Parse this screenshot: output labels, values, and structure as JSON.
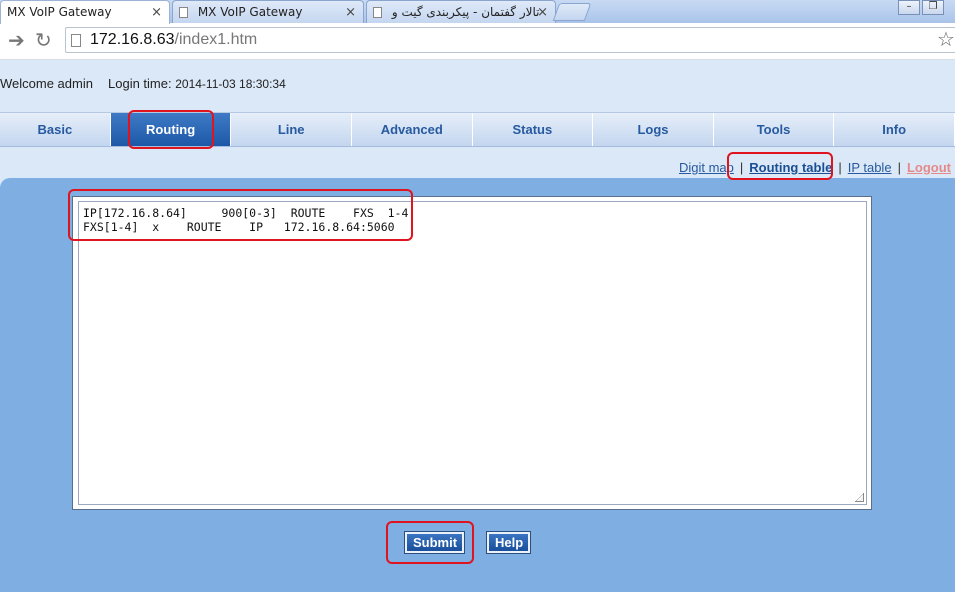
{
  "browser": {
    "tabs": [
      {
        "title": "MX VoIP Gateway",
        "close": "×"
      },
      {
        "title": "MX VoIP Gateway",
        "close": "×"
      },
      {
        "title": "تالار گفتمان - پیکربندی گیت و",
        "close": "×"
      }
    ],
    "window_buttons": {
      "minimize": "–",
      "restore": "❐"
    },
    "url_host": "172.16.8.63",
    "url_path": "/index1.htm"
  },
  "header": {
    "welcome": "Welcome admin",
    "login_label": "Login time:",
    "login_time": "2014-11-03 18:30:34"
  },
  "menu": {
    "items": [
      "Basic",
      "Routing",
      "Line",
      "Advanced",
      "Status",
      "Logs",
      "Tools",
      "Info"
    ],
    "active": "Routing"
  },
  "subnav": {
    "digit_map": "Digit map",
    "routing_table": "Routing table",
    "ip_table": "IP table",
    "logout": "Logout",
    "separator": "|"
  },
  "routing_table": {
    "text": "IP[172.16.8.64]     900[0-3]  ROUTE    FXS  1-4\nFXS[1-4]  x    ROUTE    IP   172.16.8.64:5060"
  },
  "buttons": {
    "submit": "Submit",
    "help": "Help"
  },
  "colors": {
    "menu_active": "#1d58a8",
    "content_bg": "#7faee3",
    "highlight": "#e0141e"
  }
}
